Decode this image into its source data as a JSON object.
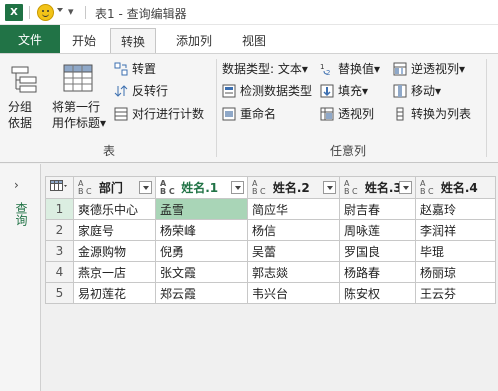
{
  "window": {
    "title": "表1 - 查询编辑器",
    "app_icon_letter": "X",
    "more_glyph": "▾"
  },
  "tabs": [
    {
      "label": "文件"
    },
    {
      "label": "开始"
    },
    {
      "label": "转换",
      "active": true
    },
    {
      "label": "添加列"
    },
    {
      "label": "视图"
    }
  ],
  "ribbon": {
    "table_group": {
      "label": "表",
      "group_by": {
        "line1": "分组",
        "line2": "依据"
      },
      "use_first_row": {
        "line1": "将第一行",
        "line2": "用作标题"
      },
      "dropdown_glyph": "▾",
      "transpose": "转置",
      "reverse_rows": "反转行",
      "count_rows": "对行进行计数"
    },
    "any_column_group": {
      "label": "任意列",
      "data_type": "数据类型: 文本",
      "detect_type": "检测数据类型",
      "rename": "重命名",
      "replace_values": "替换值",
      "fill": "填充",
      "pivot_column": "透视列",
      "unpivot_columns": "逆透视列",
      "move": "移动",
      "convert_to_list": "转换为列表",
      "dropdown_glyph": "▾"
    }
  },
  "left_pane": {
    "chevron": "›",
    "label": "查询"
  },
  "grid": {
    "type_badge_top": "A",
    "type_badge_bottom": "B C",
    "columns": [
      "部门",
      "姓名.1",
      "姓名.2",
      "姓名.3",
      "姓名.4"
    ],
    "selected_column_index": 1,
    "rows": [
      {
        "n": "1",
        "cells": [
          "爽德乐中心",
          "孟雪",
          "简应华",
          "尉吉春",
          "赵嘉玲"
        ]
      },
      {
        "n": "2",
        "cells": [
          "家庭号",
          "杨荣峰",
          "杨信",
          "周咏莲",
          "李润祥"
        ]
      },
      {
        "n": "3",
        "cells": [
          "金源购物",
          "倪勇",
          "吴蕾",
          "罗国良",
          "毕琨"
        ]
      },
      {
        "n": "4",
        "cells": [
          "燕京一店",
          "张文霞",
          "郭志燚",
          "杨路春",
          "杨丽琼"
        ]
      },
      {
        "n": "5",
        "cells": [
          "易初莲花",
          "郑云霞",
          "韦兴台",
          "陈安权",
          "王云芬"
        ]
      }
    ]
  },
  "colors": {
    "excel_green": "#217346",
    "selected_cell": "#a9d5b7"
  }
}
